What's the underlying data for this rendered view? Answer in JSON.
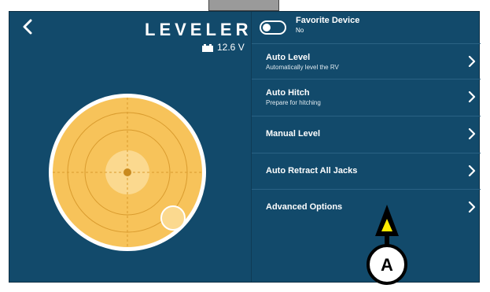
{
  "header": {
    "title": "LEVELER",
    "voltage": "12.6 V"
  },
  "favorite": {
    "title": "Favorite Device",
    "value": "No"
  },
  "menu": [
    {
      "title": "Auto Level",
      "subtitle": "Automatically level the RV"
    },
    {
      "title": "Auto Hitch",
      "subtitle": "Prepare for hitching"
    },
    {
      "title": "Manual Level",
      "subtitle": ""
    },
    {
      "title": "Auto Retract All Jacks",
      "subtitle": ""
    },
    {
      "title": "Advanced Options",
      "subtitle": ""
    }
  ],
  "callout": {
    "label": "A"
  },
  "colors": {
    "background": "#124a6b",
    "gauge": "#f7c35a",
    "gauge_center": "#fbd98f",
    "arrow_fill": "#ffeb00"
  }
}
